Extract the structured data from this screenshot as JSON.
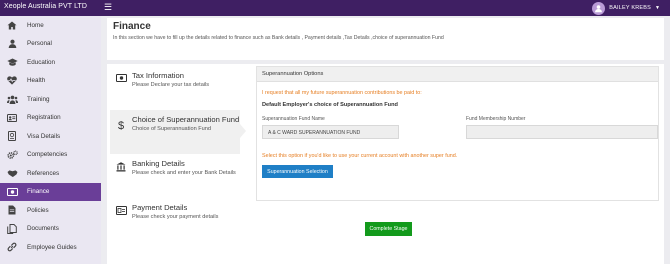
{
  "colors": {
    "topbar": "#3f1f63",
    "sidebar_bg": "#eae7f2",
    "active_nav": "#6a3e98",
    "notice": "#e67e22",
    "primary_button": "#1f7fc6",
    "success_button": "#139a1c"
  },
  "topbar": {
    "company": "Xeople Australia PVT LTD",
    "menu_icon": "hamburger-icon",
    "user_name": "BAILEY KREBS",
    "user_icon": "user-avatar-icon"
  },
  "sidebar": {
    "items": [
      {
        "label": "Home",
        "icon": "home-icon"
      },
      {
        "label": "Personal",
        "icon": "user-icon"
      },
      {
        "label": "Education",
        "icon": "graduation-cap-icon"
      },
      {
        "label": "Health",
        "icon": "heartbeat-icon"
      },
      {
        "label": "Training",
        "icon": "users-icon"
      },
      {
        "label": "Registration",
        "icon": "id-card-icon"
      },
      {
        "label": "Visa Details",
        "icon": "passport-icon"
      },
      {
        "label": "Competencies",
        "icon": "cogs-icon"
      },
      {
        "label": "References",
        "icon": "handshake-icon"
      },
      {
        "label": "Finance",
        "icon": "money-icon",
        "active": true
      },
      {
        "label": "Policies",
        "icon": "file-icon"
      },
      {
        "label": "Documents",
        "icon": "documents-icon"
      },
      {
        "label": "Employee Guides",
        "icon": "link-icon"
      }
    ]
  },
  "header": {
    "title": "Finance",
    "description": "In this section we have to fill up the details related to finance such as Bank details , Payment details ,Tax Details ,choice of superannuation Fund"
  },
  "steps": [
    {
      "title": "Tax Information",
      "subtitle": "Please Declare your tax details",
      "icon": "money-bill-icon"
    },
    {
      "title": "Choice of Superannuation Fund",
      "subtitle": "Choice of Superannuation Fund",
      "icon": "dollar-icon",
      "active": true
    },
    {
      "title": "Banking Details",
      "subtitle": "Please check and enter your Bank Details",
      "icon": "bank-icon"
    },
    {
      "title": "Payment Details",
      "subtitle": "Please check your payment details",
      "icon": "money-check-icon"
    }
  ],
  "panel": {
    "heading": "Superannuation Options",
    "request_text": "I request that all my future superannuation contributions be paid to:",
    "default_heading": "Default Employer's choice of Superannuation Fund",
    "fund_name_label": "Superannuation Fund Name",
    "fund_name_value": "A & C WARD SUPERANNUATION FUND",
    "membership_label": "Fund Membership Number",
    "membership_value": "",
    "option_text": "Select this option if you'd like to use your current account with another super fund.",
    "selection_button": "Superannuation Selection"
  },
  "actions": {
    "complete_button": "Complete Stage"
  }
}
